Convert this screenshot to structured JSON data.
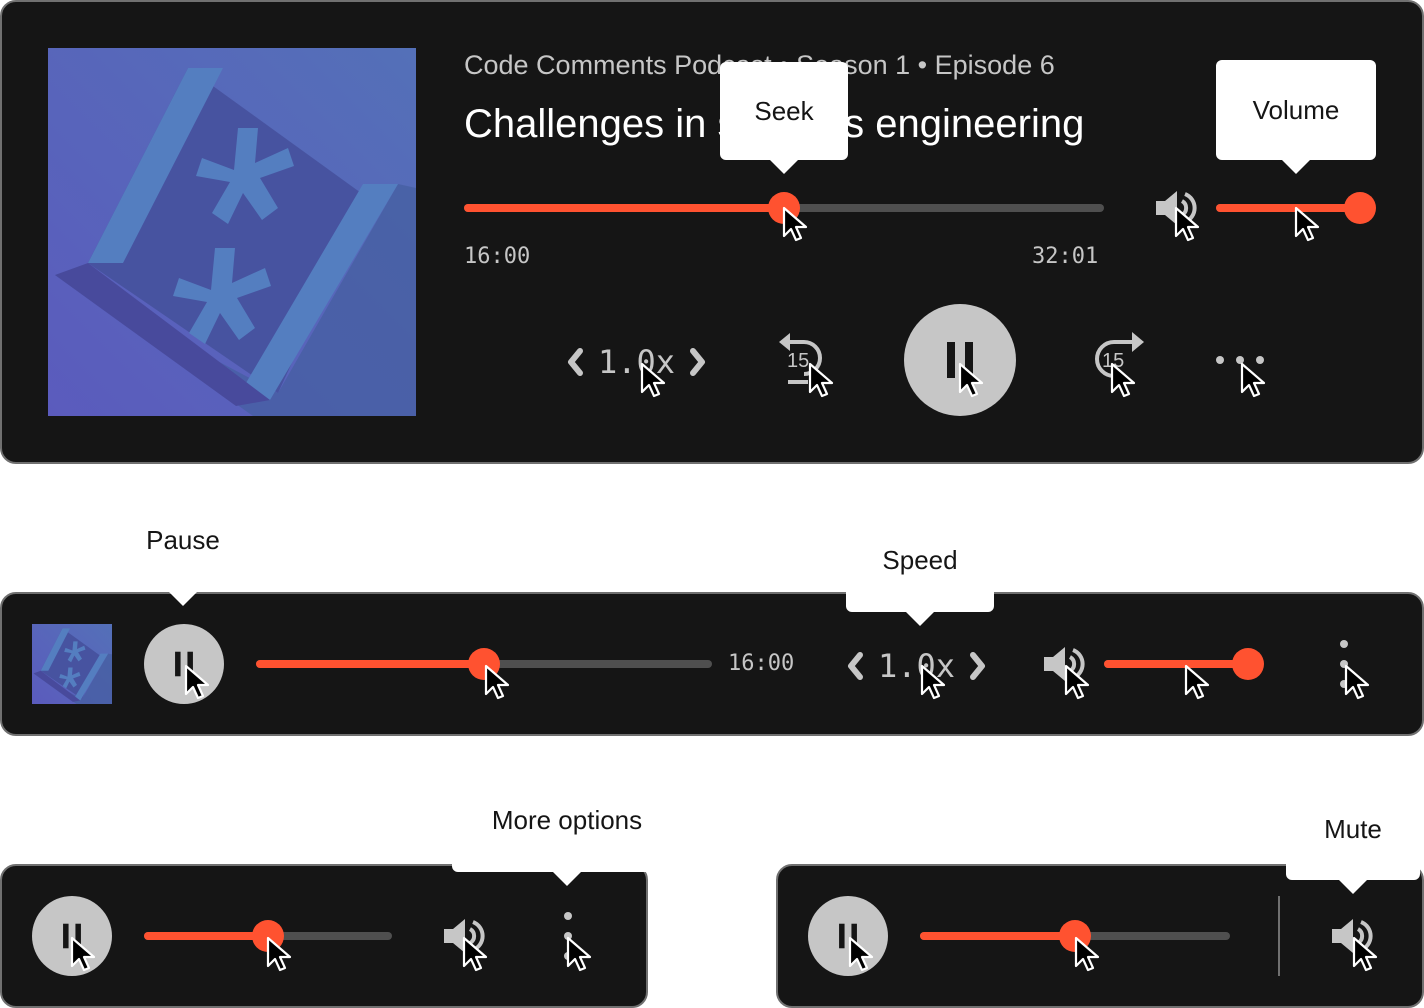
{
  "colors": {
    "accent": "#ff5230",
    "panel_bg": "#151515",
    "control_gray": "#c6c6c6",
    "track_gray": "#4f4f4f",
    "artwork_blue": "#5b5bbd"
  },
  "full_player": {
    "artwork_icon": "podcast-artwork-asterisks",
    "series_line": "Code Comments Podcast • Season 1 • Episode 6",
    "episode_title": "Challenges in systems engineering",
    "seek": {
      "progress_percent": 50,
      "elapsed": "16:00",
      "duration": "32:01"
    },
    "volume": {
      "level_percent": 100,
      "icon": "volume-icon"
    },
    "speed": {
      "value": "1.0x",
      "decrease_icon": "chevron-left-icon",
      "increase_icon": "chevron-right-icon"
    },
    "rewind": {
      "label": "15",
      "icon": "rewind-15-icon"
    },
    "play_pause": {
      "state": "playing",
      "icon": "pause-icon"
    },
    "forward": {
      "label": "15",
      "icon": "forward-15-icon"
    },
    "more": {
      "icon": "more-horizontal-icon"
    },
    "tooltips": {
      "seek": "Seek",
      "volume": "Volume"
    }
  },
  "compact_player": {
    "seek": {
      "progress_percent": 50,
      "elapsed": "16:00"
    },
    "speed": {
      "value": "1.0x"
    },
    "volume": {
      "level_percent": 100
    },
    "tooltips": {
      "pause": "Pause",
      "speed": "Speed"
    }
  },
  "mini_player_more": {
    "seek": {
      "progress_percent": 50
    },
    "tooltips": {
      "more": "More options"
    }
  },
  "mini_player_mute": {
    "seek": {
      "progress_percent": 50
    },
    "tooltips": {
      "mute": "Mute"
    }
  }
}
